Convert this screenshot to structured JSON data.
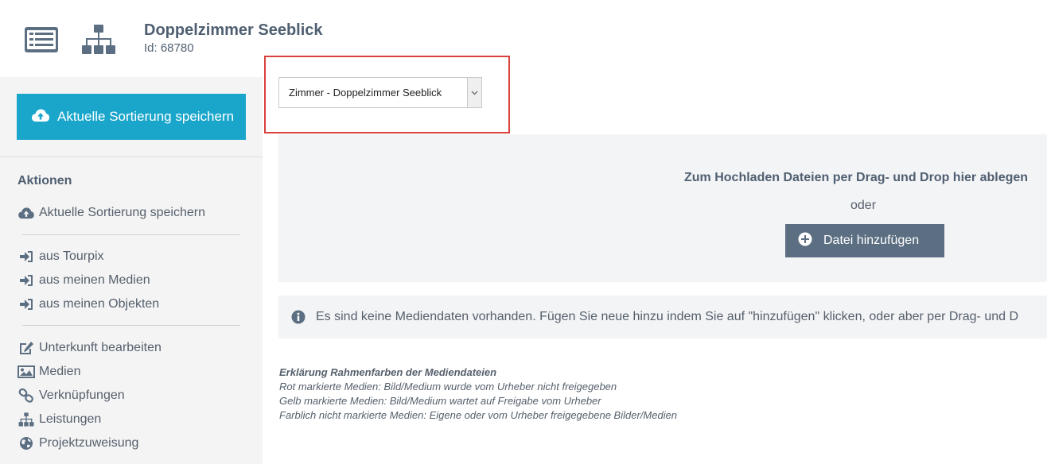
{
  "header": {
    "title": "Doppelzimmer Seeblick",
    "id_label": "Id: 68780",
    "icons": [
      "list-view-icon",
      "hierarchy-icon"
    ]
  },
  "sidebar": {
    "save_button_label": "Aktuelle Sortierung speichern",
    "actions_heading": "Aktionen",
    "action_save_label": "Aktuelle Sortierung speichern",
    "import_items": [
      {
        "label": "aus Tourpix",
        "icon": "sign-in-icon"
      },
      {
        "label": "aus meinen Medien",
        "icon": "sign-in-icon"
      },
      {
        "label": "aus meinen Objekten",
        "icon": "sign-in-icon"
      }
    ],
    "nav_items": [
      {
        "label": "Unterkunft bearbeiten",
        "icon": "edit-icon"
      },
      {
        "label": "Medien",
        "icon": "image-icon"
      },
      {
        "label": "Verknüpfungen",
        "icon": "link-icon"
      },
      {
        "label": "Leistungen",
        "icon": "sitemap-icon"
      },
      {
        "label": "Projektzuweisung",
        "icon": "globe-icon"
      }
    ]
  },
  "main": {
    "select_value": "Zimmer - Doppelzimmer Seeblick",
    "dropzone_text": "Zum Hochladen Dateien per Drag- und Drop hier ablegen",
    "or_text": "oder",
    "add_file_label": "Datei hinzufügen",
    "info_text": "Es sind keine Mediendaten vorhanden. Fügen Sie neue hinzu indem Sie auf \"hinzufügen\" klicken, oder aber per Drag- und D",
    "legend_title": "Erklärung Rahmenfarben der Mediendateien",
    "legend_lines": [
      "Rot markierte Medien: Bild/Medium wurde vom Urheber nicht freigegeben",
      "Gelb markierte Medien: Bild/Medium wartet auf Freigabe vom Urheber",
      "Farblich nicht markierte Medien: Eigene oder vom Urheber freigegebene Bilder/Medien"
    ]
  },
  "colors": {
    "primary_button": "#1aa6cb",
    "secondary_button": "#5c6f82",
    "highlight_border": "#d9413e",
    "sidebar_bg": "#f4f4f5",
    "panel_bg": "#f3f4f6",
    "text": "#555f6b"
  }
}
